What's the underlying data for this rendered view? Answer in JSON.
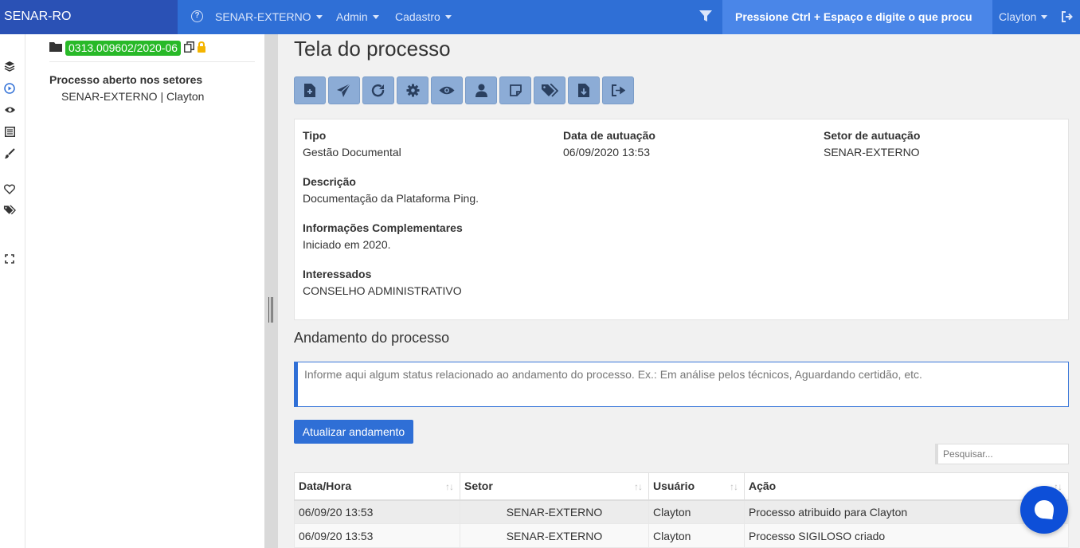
{
  "navbar": {
    "brand": "SENAR-RO",
    "items": [
      {
        "label": "SENAR-EXTERNO"
      },
      {
        "label": "Admin"
      },
      {
        "label": "Cadastro"
      }
    ],
    "search_placeholder": "Pressione Ctrl + Espaço e digite o que procu",
    "user": "Clayton"
  },
  "left_panel": {
    "process_number": "0313.009602/2020-06",
    "open_in_sectors_title": "Processo aberto nos setores",
    "sector_user": "SENAR-EXTERNO | Clayton"
  },
  "main": {
    "title": "Tela do processo",
    "toolbar_icons": [
      "file-plus-icon",
      "send-icon",
      "redo-icon",
      "gear-icon",
      "eye-icon",
      "user-icon",
      "sticky-note-icon",
      "tags-icon",
      "file-download-icon",
      "sign-out-icon"
    ],
    "fields": {
      "tipo_label": "Tipo",
      "tipo_value": "Gestão Documental",
      "data_label": "Data de autuação",
      "data_value": "06/09/2020 13:53",
      "setor_label": "Setor de autuação",
      "setor_value": "SENAR-EXTERNO",
      "descricao_label": "Descrição",
      "descricao_value": "Documentação da Plataforma Ping.",
      "info_label": "Informações Complementares",
      "info_value": "Iniciado em 2020.",
      "interessados_label": "Interessados",
      "interessados_value": "CONSELHO ADMINISTRATIVO"
    },
    "andamento_title": "Andamento do processo",
    "status_placeholder": "Informe aqui algum status relacionado ao andamento do processo. Ex.: Em análise pelos técnicos, Aguardando certidão, etc.",
    "update_button": "Atualizar andamento",
    "table_search_placeholder": "Pesquisar...",
    "table": {
      "columns": [
        "Data/Hora",
        "Setor",
        "Usuário",
        "Ação"
      ],
      "rows": [
        {
          "datetime": "06/09/20 13:53",
          "sector": "SENAR-EXTERNO",
          "user": "Clayton",
          "action": "Processo atribuido para Clayton"
        },
        {
          "datetime": "06/09/20 13:53",
          "sector": "SENAR-EXTERNO",
          "user": "Clayton",
          "action": "Processo SIGILOSO criado"
        }
      ]
    }
  },
  "colors": {
    "navbar": "#2f6fd6",
    "brand_bg": "#2a51b5",
    "badge_green": "#28b928",
    "toolbar_button": "#8cacd6",
    "chat_bubble": "#0d4fd8"
  }
}
